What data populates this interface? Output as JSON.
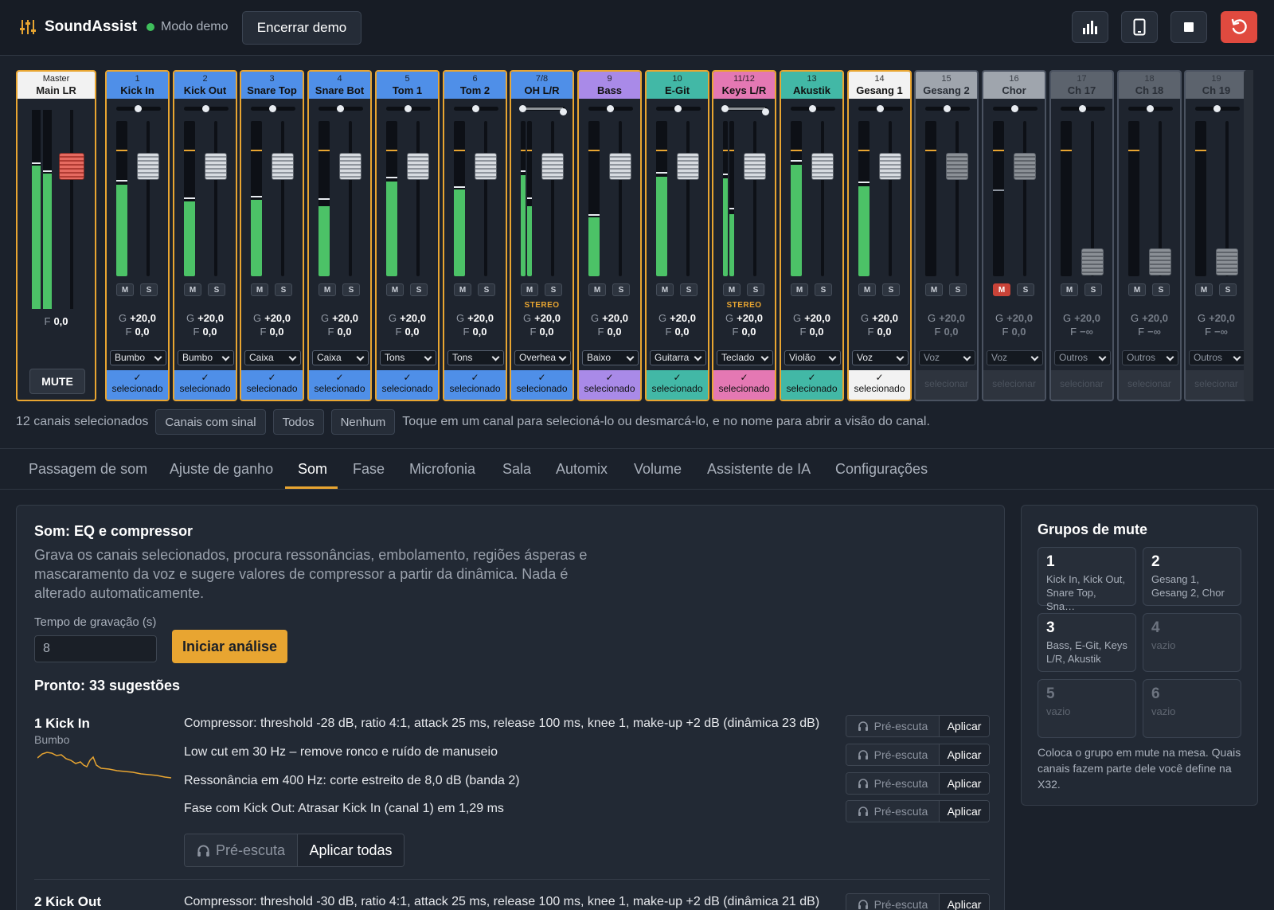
{
  "app": {
    "name": "SoundAssist",
    "demo_label": "Modo demo",
    "end_demo": "Encerrar demo"
  },
  "toolbar_icons": [
    "bar-chart-icon",
    "tablet-icon",
    "stop-icon",
    "reset-icon"
  ],
  "master": {
    "num": "Master",
    "name": "Main LR",
    "fader_prefix": "F",
    "fader": "0,0",
    "mute": "MUTE"
  },
  "channels": [
    {
      "num": "1",
      "name": "Kick In",
      "color": "#4f8fe8",
      "cat": "Bumbo",
      "sel": true,
      "level": 0.59,
      "peak": 0.61
    },
    {
      "num": "2",
      "name": "Kick Out",
      "color": "#4f8fe8",
      "cat": "Bumbo",
      "sel": true,
      "level": 0.48,
      "peak": 0.5
    },
    {
      "num": "3",
      "name": "Snare Top",
      "color": "#4f8fe8",
      "cat": "Caixa",
      "sel": true,
      "level": 0.49,
      "peak": 0.51
    },
    {
      "num": "4",
      "name": "Snare Bot",
      "color": "#4f8fe8",
      "cat": "Caixa",
      "sel": true,
      "level": 0.45,
      "peak": 0.49
    },
    {
      "num": "5",
      "name": "Tom 1",
      "color": "#4f8fe8",
      "cat": "Tons",
      "sel": true,
      "level": 0.61,
      "peak": 0.63
    },
    {
      "num": "6",
      "name": "Tom 2",
      "color": "#4f8fe8",
      "cat": "Tons",
      "sel": true,
      "level": 0.56,
      "peak": 0.57
    },
    {
      "num": "7/8",
      "name": "OH L/R",
      "color": "#4f8fe8",
      "cat": "Overhea",
      "sel": true,
      "stereo": true,
      "level": 0.65,
      "level2": 0.45,
      "peak": 0.67,
      "peak2": 0.5
    },
    {
      "num": "9",
      "name": "Bass",
      "color": "#a98ae8",
      "cat": "Baixo",
      "sel": true,
      "level": 0.38,
      "peak": 0.39
    },
    {
      "num": "10",
      "name": "E-Git",
      "color": "#42b8a6",
      "cat": "Guitarra",
      "sel": true,
      "level": 0.64,
      "peak": 0.66
    },
    {
      "num": "11/12",
      "name": "Keys L/R",
      "color": "#e478b3",
      "cat": "Teclado",
      "sel": true,
      "stereo": true,
      "level": 0.63,
      "level2": 0.4,
      "peak": 0.65,
      "peak2": 0.43
    },
    {
      "num": "13",
      "name": "Akustik",
      "color": "#42b8a6",
      "cat": "Violão",
      "sel": true,
      "level": 0.72,
      "peak": 0.74
    },
    {
      "num": "14",
      "name": "Gesang 1",
      "color": "#f2f2f2",
      "cat": "Voz",
      "sel": true,
      "level": 0.58,
      "peak": 0.6
    },
    {
      "num": "15",
      "name": "Gesang 2",
      "color": "#9fa5ad",
      "cat": "Voz",
      "sel": false,
      "level": 0,
      "peak": 0
    },
    {
      "num": "16",
      "name": "Chor",
      "color": "#9fa5ad",
      "cat": "Voz",
      "sel": false,
      "level": 0,
      "peak": 0.55,
      "mute": true
    },
    {
      "num": "17",
      "name": "Ch 17",
      "color": "#5c636d",
      "cat": "Outros",
      "sel": false,
      "level": 0,
      "peak": 0,
      "inf": true
    },
    {
      "num": "18",
      "name": "Ch 18",
      "color": "#5c636d",
      "cat": "Outros",
      "sel": false,
      "level": 0,
      "peak": 0,
      "inf": true
    },
    {
      "num": "19",
      "name": "Ch 19",
      "color": "#5c636d",
      "cat": "Outros",
      "sel": false,
      "level": 0,
      "peak": 0,
      "inf": true
    }
  ],
  "strip_labels": {
    "m": "M",
    "s": "S",
    "stereo": "STEREO",
    "g": "G",
    "f": "F",
    "gain": "+20,0",
    "fader": "0,0",
    "fader_inf": "−∞",
    "selected": "selecionado",
    "select": "selecionar",
    "check": "✓"
  },
  "selection": {
    "count": "12 canais selecionados",
    "chips": [
      "Canais com sinal",
      "Todos",
      "Nenhum"
    ],
    "hint": "Toque em um canal para selecioná-lo ou desmarcá-lo, e no nome para abrir a visão do canal."
  },
  "tabs": [
    "Passagem de som",
    "Ajuste de ganho",
    "Som",
    "Fase",
    "Microfonia",
    "Sala",
    "Automix",
    "Volume",
    "Assistente de IA",
    "Configurações"
  ],
  "active_tab": "Som",
  "panel": {
    "title": "Som: EQ e compressor",
    "desc": "Grava os canais selecionados, procura ressonâncias, embolamento, regiões ásperas e mascaramento da voz e sugere valores de compressor a partir da dinâmica. Nada é alterado automaticamente.",
    "rec_label": "Tempo de gravação (s)",
    "rec_value": "8",
    "start": "Iniciar análise",
    "ready": "Pronto: 33 sugestões",
    "prelisten": "Pré-escuta",
    "apply": "Aplicar",
    "apply_all": "Aplicar todas",
    "channels": [
      {
        "name": "1 Kick In",
        "cat": "Bumbo",
        "suggestions": [
          "Compressor: threshold -28 dB, ratio 4:1, attack 25 ms, release 100 ms, knee 1, make-up +2 dB (dinâmica 23 dB)",
          "Low cut em 30 Hz – remove ronco e ruído de manuseio",
          "Ressonância em 400 Hz: corte estreito de 8,0 dB (banda 2)",
          "Fase com Kick Out: Atrasar Kick In (canal 1) em 1,29 ms"
        ]
      },
      {
        "name": "2 Kick Out",
        "cat": "",
        "suggestions": [
          "Compressor: threshold -30 dB, ratio 4:1, attack 25 ms, release 100 ms, knee 1, make-up +2 dB (dinâmica 21 dB)"
        ]
      }
    ]
  },
  "mute_groups": {
    "title": "Grupos de mute",
    "groups": [
      {
        "n": "1",
        "members": "Kick In, Kick Out, Snare Top, Sna…"
      },
      {
        "n": "2",
        "members": "Gesang 1, Gesang 2, Chor"
      },
      {
        "n": "3",
        "members": "Bass, E-Git, Keys L/R, Akustik"
      },
      {
        "n": "4",
        "members": "vazio",
        "empty": true
      },
      {
        "n": "5",
        "members": "vazio",
        "empty": true
      },
      {
        "n": "6",
        "members": "vazio",
        "empty": true
      }
    ],
    "note": "Coloca o grupo em mute na mesa. Quais canais fazem parte dele você define na X32."
  },
  "colors": {
    "accent": "#e8a531",
    "meter": "#4cc267",
    "danger": "#e04a3f"
  }
}
